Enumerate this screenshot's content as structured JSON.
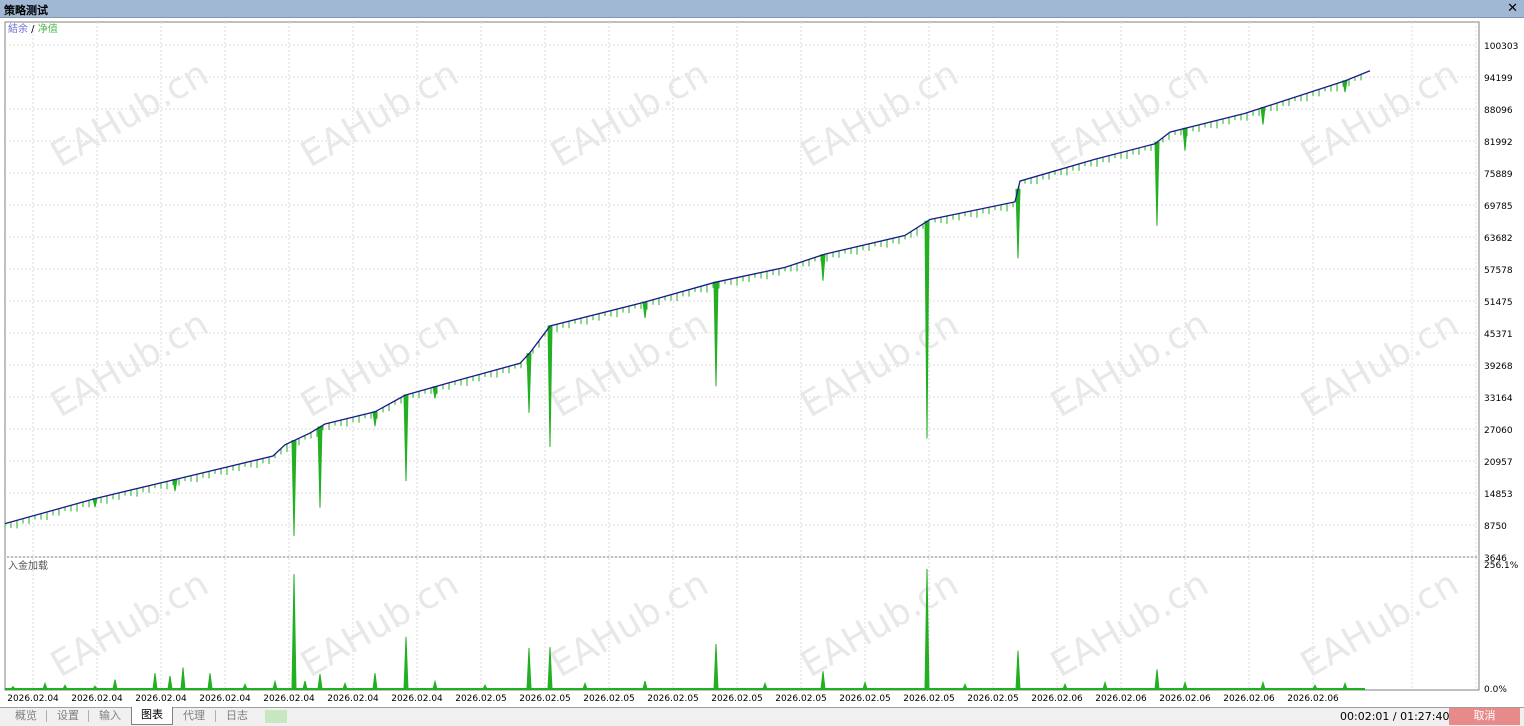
{
  "window": {
    "title": "策略测试",
    "close_glyph": "✕"
  },
  "chart_data": {
    "type": "line",
    "title": "",
    "legend": {
      "balance_label": "結余",
      "separator": " / ",
      "equity_label": "净值",
      "balance_color": "#6b6bd0",
      "equity_color": "#4cb84c"
    },
    "y_axis": {
      "ticks": [
        "100303",
        "94199",
        "88096",
        "81992",
        "75889",
        "69785",
        "63682",
        "57578",
        "51475",
        "45371",
        "39268",
        "33164",
        "27060",
        "20957",
        "14853",
        "8750",
        "3646"
      ],
      "ylim": [
        3646,
        100303
      ]
    },
    "x_axis": {
      "ticks": [
        "2026.02.04",
        "2026.02.04",
        "2026.02.04",
        "2026.02.04",
        "2026.02.04",
        "2026.02.04",
        "2026.02.04",
        "2026.02.05",
        "2026.02.05",
        "2026.02.05",
        "2026.02.05",
        "2026.02.05",
        "2026.02.05",
        "2026.02.05",
        "2026.02.05",
        "2026.02.05",
        "2026.02.06",
        "2026.02.06",
        "2026.02.06",
        "2026.02.06",
        "2026.02.06"
      ]
    },
    "series": [
      {
        "name": "結余",
        "color": "#1a1a8c",
        "points": [
          [
            0,
            9900
          ],
          [
            90,
            14600
          ],
          [
            170,
            18200
          ],
          [
            268,
            22600
          ],
          [
            280,
            24700
          ],
          [
            305,
            26900
          ],
          [
            320,
            28600
          ],
          [
            370,
            30900
          ],
          [
            400,
            34000
          ],
          [
            445,
            36400
          ],
          [
            515,
            40000
          ],
          [
            525,
            42000
          ],
          [
            545,
            47000
          ],
          [
            640,
            51500
          ],
          [
            710,
            55200
          ],
          [
            780,
            58000
          ],
          [
            820,
            60500
          ],
          [
            900,
            64000
          ],
          [
            925,
            67000
          ],
          [
            1010,
            70300
          ],
          [
            1015,
            74200
          ],
          [
            1090,
            78300
          ],
          [
            1150,
            81200
          ],
          [
            1165,
            83400
          ],
          [
            1240,
            86900
          ],
          [
            1340,
            93000
          ],
          [
            1365,
            94900
          ]
        ]
      },
      {
        "name": "净值",
        "color": "#22b022",
        "drawdowns": [
          [
            90,
            13000
          ],
          [
            170,
            16000
          ],
          [
            289,
            7600
          ],
          [
            315,
            12900
          ],
          [
            370,
            28200
          ],
          [
            401,
            17900
          ],
          [
            430,
            33400
          ],
          [
            524,
            30700
          ],
          [
            545,
            24300
          ],
          [
            640,
            48500
          ],
          [
            711,
            35700
          ],
          [
            818,
            55500
          ],
          [
            922,
            25900
          ],
          [
            1013,
            59700
          ],
          [
            1152,
            65800
          ],
          [
            1180,
            79900
          ],
          [
            1258,
            84800
          ],
          [
            1340,
            90900
          ]
        ]
      }
    ],
    "sub_panel": {
      "label": "入金加载",
      "y_ticks": [
        "256.1%",
        "0.0%"
      ],
      "ylim": [
        0,
        256.1
      ],
      "spikes": [
        [
          8,
          3
        ],
        [
          40,
          10
        ],
        [
          60,
          6
        ],
        [
          90,
          4
        ],
        [
          110,
          18
        ],
        [
          150,
          32
        ],
        [
          165,
          26
        ],
        [
          178,
          44
        ],
        [
          205,
          32
        ],
        [
          240,
          8
        ],
        [
          270,
          14
        ],
        [
          289,
          245
        ],
        [
          300,
          15
        ],
        [
          315,
          30
        ],
        [
          340,
          10
        ],
        [
          370,
          32
        ],
        [
          401,
          110
        ],
        [
          430,
          14
        ],
        [
          480,
          6
        ],
        [
          524,
          86
        ],
        [
          545,
          88
        ],
        [
          580,
          10
        ],
        [
          640,
          15
        ],
        [
          711,
          95
        ],
        [
          760,
          10
        ],
        [
          818,
          36
        ],
        [
          860,
          12
        ],
        [
          922,
          256
        ],
        [
          960,
          8
        ],
        [
          1013,
          80
        ],
        [
          1060,
          8
        ],
        [
          1100,
          12
        ],
        [
          1152,
          40
        ],
        [
          1180,
          12
        ],
        [
          1258,
          12
        ],
        [
          1310,
          6
        ],
        [
          1340,
          10
        ]
      ]
    },
    "watermark": "EAHub.cn"
  },
  "tabs": [
    "概览",
    "设置",
    "输入",
    "图表",
    "代理",
    "日志"
  ],
  "active_tab": 3,
  "status": {
    "timer": "00:02:01 / 01:27:40",
    "cancel_label": "取消"
  }
}
